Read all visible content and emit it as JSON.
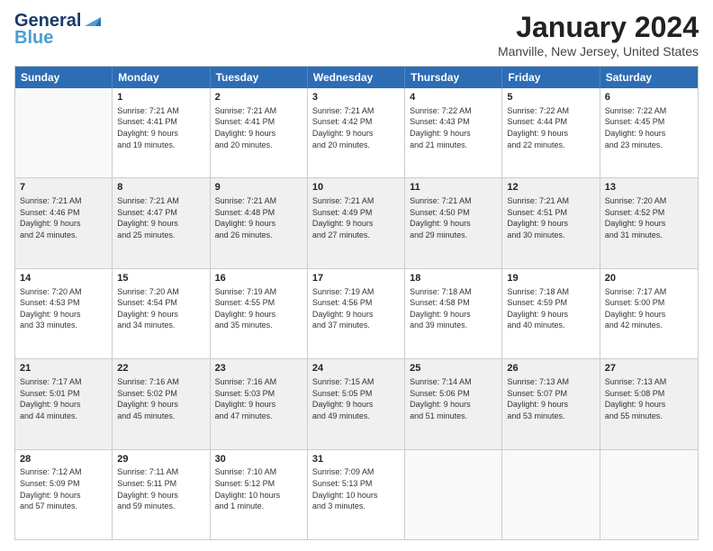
{
  "logo": {
    "line1": "General",
    "line2": "Blue"
  },
  "title": "January 2024",
  "subtitle": "Manville, New Jersey, United States",
  "headers": [
    "Sunday",
    "Monday",
    "Tuesday",
    "Wednesday",
    "Thursday",
    "Friday",
    "Saturday"
  ],
  "weeks": [
    [
      {
        "day": "",
        "content": ""
      },
      {
        "day": "1",
        "content": "Sunrise: 7:21 AM\nSunset: 4:41 PM\nDaylight: 9 hours\nand 19 minutes."
      },
      {
        "day": "2",
        "content": "Sunrise: 7:21 AM\nSunset: 4:41 PM\nDaylight: 9 hours\nand 20 minutes."
      },
      {
        "day": "3",
        "content": "Sunrise: 7:21 AM\nSunset: 4:42 PM\nDaylight: 9 hours\nand 20 minutes."
      },
      {
        "day": "4",
        "content": "Sunrise: 7:22 AM\nSunset: 4:43 PM\nDaylight: 9 hours\nand 21 minutes."
      },
      {
        "day": "5",
        "content": "Sunrise: 7:22 AM\nSunset: 4:44 PM\nDaylight: 9 hours\nand 22 minutes."
      },
      {
        "day": "6",
        "content": "Sunrise: 7:22 AM\nSunset: 4:45 PM\nDaylight: 9 hours\nand 23 minutes."
      }
    ],
    [
      {
        "day": "7",
        "content": "Sunrise: 7:21 AM\nSunset: 4:46 PM\nDaylight: 9 hours\nand 24 minutes."
      },
      {
        "day": "8",
        "content": "Sunrise: 7:21 AM\nSunset: 4:47 PM\nDaylight: 9 hours\nand 25 minutes."
      },
      {
        "day": "9",
        "content": "Sunrise: 7:21 AM\nSunset: 4:48 PM\nDaylight: 9 hours\nand 26 minutes."
      },
      {
        "day": "10",
        "content": "Sunrise: 7:21 AM\nSunset: 4:49 PM\nDaylight: 9 hours\nand 27 minutes."
      },
      {
        "day": "11",
        "content": "Sunrise: 7:21 AM\nSunset: 4:50 PM\nDaylight: 9 hours\nand 29 minutes."
      },
      {
        "day": "12",
        "content": "Sunrise: 7:21 AM\nSunset: 4:51 PM\nDaylight: 9 hours\nand 30 minutes."
      },
      {
        "day": "13",
        "content": "Sunrise: 7:20 AM\nSunset: 4:52 PM\nDaylight: 9 hours\nand 31 minutes."
      }
    ],
    [
      {
        "day": "14",
        "content": "Sunrise: 7:20 AM\nSunset: 4:53 PM\nDaylight: 9 hours\nand 33 minutes."
      },
      {
        "day": "15",
        "content": "Sunrise: 7:20 AM\nSunset: 4:54 PM\nDaylight: 9 hours\nand 34 minutes."
      },
      {
        "day": "16",
        "content": "Sunrise: 7:19 AM\nSunset: 4:55 PM\nDaylight: 9 hours\nand 35 minutes."
      },
      {
        "day": "17",
        "content": "Sunrise: 7:19 AM\nSunset: 4:56 PM\nDaylight: 9 hours\nand 37 minutes."
      },
      {
        "day": "18",
        "content": "Sunrise: 7:18 AM\nSunset: 4:58 PM\nDaylight: 9 hours\nand 39 minutes."
      },
      {
        "day": "19",
        "content": "Sunrise: 7:18 AM\nSunset: 4:59 PM\nDaylight: 9 hours\nand 40 minutes."
      },
      {
        "day": "20",
        "content": "Sunrise: 7:17 AM\nSunset: 5:00 PM\nDaylight: 9 hours\nand 42 minutes."
      }
    ],
    [
      {
        "day": "21",
        "content": "Sunrise: 7:17 AM\nSunset: 5:01 PM\nDaylight: 9 hours\nand 44 minutes."
      },
      {
        "day": "22",
        "content": "Sunrise: 7:16 AM\nSunset: 5:02 PM\nDaylight: 9 hours\nand 45 minutes."
      },
      {
        "day": "23",
        "content": "Sunrise: 7:16 AM\nSunset: 5:03 PM\nDaylight: 9 hours\nand 47 minutes."
      },
      {
        "day": "24",
        "content": "Sunrise: 7:15 AM\nSunset: 5:05 PM\nDaylight: 9 hours\nand 49 minutes."
      },
      {
        "day": "25",
        "content": "Sunrise: 7:14 AM\nSunset: 5:06 PM\nDaylight: 9 hours\nand 51 minutes."
      },
      {
        "day": "26",
        "content": "Sunrise: 7:13 AM\nSunset: 5:07 PM\nDaylight: 9 hours\nand 53 minutes."
      },
      {
        "day": "27",
        "content": "Sunrise: 7:13 AM\nSunset: 5:08 PM\nDaylight: 9 hours\nand 55 minutes."
      }
    ],
    [
      {
        "day": "28",
        "content": "Sunrise: 7:12 AM\nSunset: 5:09 PM\nDaylight: 9 hours\nand 57 minutes."
      },
      {
        "day": "29",
        "content": "Sunrise: 7:11 AM\nSunset: 5:11 PM\nDaylight: 9 hours\nand 59 minutes."
      },
      {
        "day": "30",
        "content": "Sunrise: 7:10 AM\nSunset: 5:12 PM\nDaylight: 10 hours\nand 1 minute."
      },
      {
        "day": "31",
        "content": "Sunrise: 7:09 AM\nSunset: 5:13 PM\nDaylight: 10 hours\nand 3 minutes."
      },
      {
        "day": "",
        "content": ""
      },
      {
        "day": "",
        "content": ""
      },
      {
        "day": "",
        "content": ""
      }
    ]
  ]
}
